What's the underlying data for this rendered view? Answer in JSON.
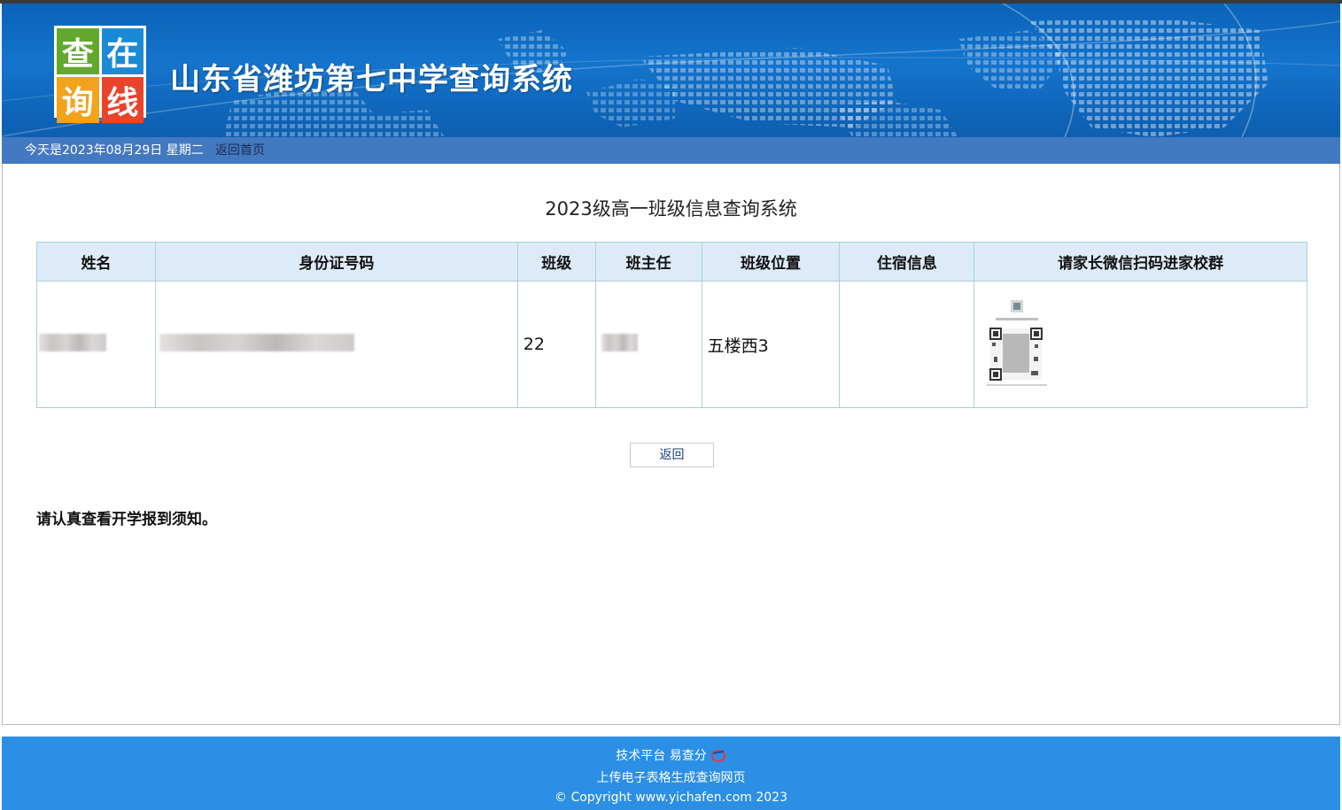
{
  "header": {
    "logo_chars": [
      "查",
      "在",
      "询",
      "线"
    ],
    "site_title": "山东省潍坊第七中学查询系统"
  },
  "infobar": {
    "date_text": "今天是2023年08月29日  星期二",
    "home_link": "返回首页"
  },
  "main": {
    "heading": "2023级高一班级信息查询系统",
    "table": {
      "columns": [
        "姓名",
        "身份证号码",
        "班级",
        "班主任",
        "班级位置",
        "住宿信息",
        "请家长微信扫码进家校群"
      ],
      "row": {
        "name": "",
        "id_number": "",
        "class": "22",
        "head_teacher": "",
        "location": "五楼西3",
        "dorm": ""
      }
    },
    "back_button": "返回",
    "notice": "请认真查看开学报到须知。"
  },
  "footer": {
    "line1": "技术平台 易查分",
    "line2": "上传电子表格生成查询网页",
    "line3": "© Copyright www.yichafen.com 2023"
  },
  "colors": {
    "banner": "#1474cc",
    "infobar": "#4379c0",
    "table_header": "#ddebf9",
    "footer": "#2b8fe6"
  }
}
